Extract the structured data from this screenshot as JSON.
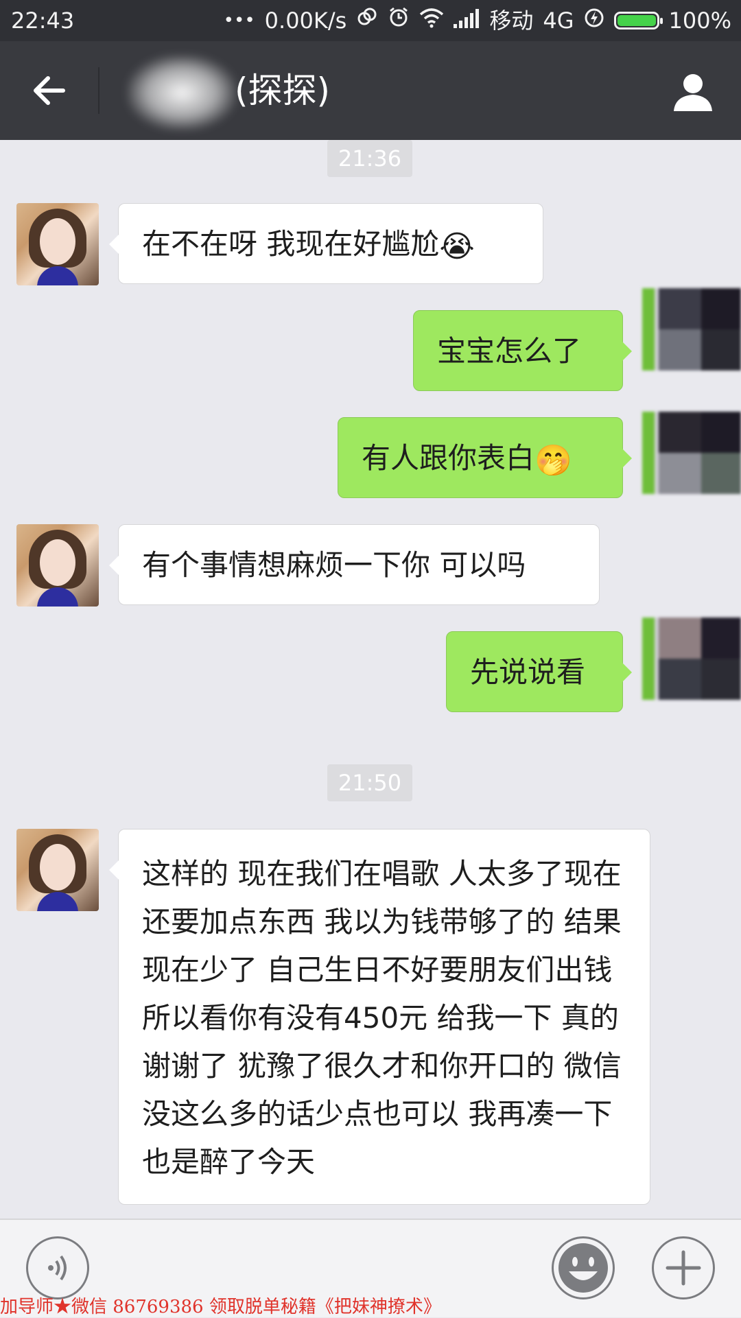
{
  "status_bar": {
    "time": "22:43",
    "dots": "•••",
    "network_speed": "0.00K/s",
    "carrier": "移动",
    "network_type": "4G",
    "battery": "100%",
    "battery_level": 1.0,
    "battery_color": "#45d24a"
  },
  "header": {
    "title": "(探探)",
    "back_icon": "arrow-left-icon",
    "profile_icon": "person-icon"
  },
  "messages": [
    {
      "type": "timestamp",
      "text": "21:36"
    },
    {
      "side": "left",
      "text": "在不在呀 我现在好尴尬",
      "emoji": "😭"
    },
    {
      "side": "right",
      "text": "宝宝怎么了"
    },
    {
      "side": "right",
      "text": "有人跟你表白",
      "emoji": "🤭"
    },
    {
      "side": "left",
      "text": "有个事情想麻烦一下你 可以吗"
    },
    {
      "side": "right",
      "text": "先说说看"
    },
    {
      "type": "timestamp",
      "text": "21:50"
    },
    {
      "side": "left",
      "text": "这样的 现在我们在唱歌 人太多了现在还要加点东西 我以为钱带够了的 结果现在少了 自己生日不好要朋友们出钱 所以看你有没有450元 给我一下 真的谢谢了 犹豫了很久才和你开口的 微信没这么多的话少点也可以 我再凑一下 也是醉了今天"
    }
  ],
  "input_bar": {
    "voice_icon": "voice-icon",
    "emoji_icon": "smiley-icon",
    "plus_icon": "plus-icon"
  },
  "watermark": "加导师★微信 86769386 领取脱单秘籍《把妹神撩术》",
  "colors": {
    "sent_bubble": "#9ee85f",
    "received_bubble": "#ffffff",
    "title_bar": "#393a3f",
    "watermark": "#e0332b"
  }
}
